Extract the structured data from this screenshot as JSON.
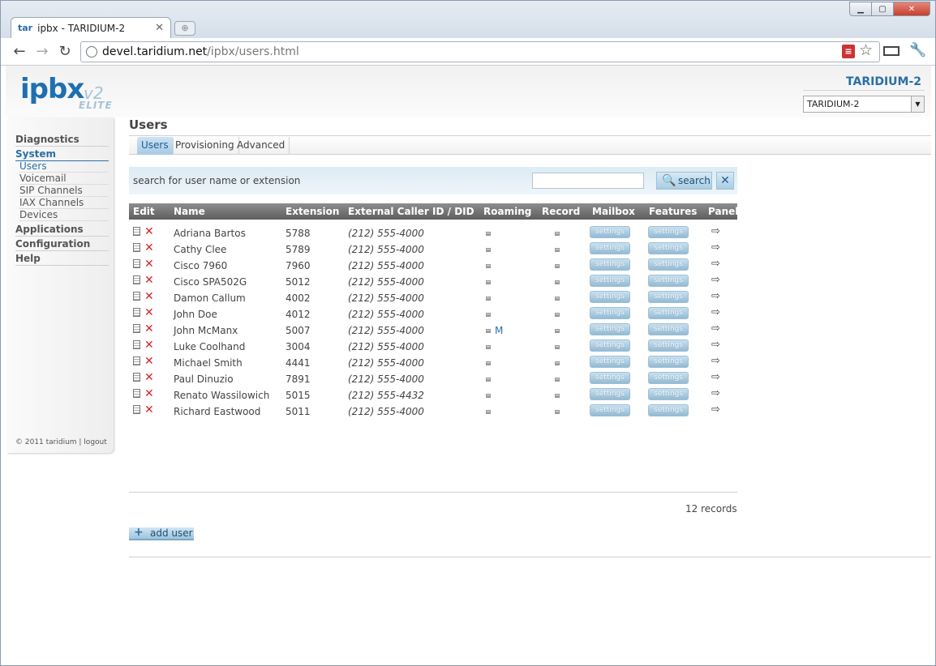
{
  "browser": {
    "tab_title": "ipbx - TARIDIUM-2",
    "tab_favicon": "tar",
    "url_host": "devel.taridium.net",
    "url_path": "/ipbx/users.html"
  },
  "logo": {
    "word": "ipbx",
    "version": "v2",
    "edition": "ELITE"
  },
  "server": {
    "name": "TARIDIUM-2",
    "selected": "TARIDIUM-2"
  },
  "sidebar": {
    "sections": [
      {
        "label": "Diagnostics"
      },
      {
        "label": "System"
      },
      {
        "label": "Applications"
      },
      {
        "label": "Configuration"
      },
      {
        "label": "Help"
      }
    ],
    "system_items": [
      {
        "label": "Users"
      },
      {
        "label": "Voicemail"
      },
      {
        "label": "SIP Channels"
      },
      {
        "label": "IAX Channels"
      },
      {
        "label": "Devices"
      }
    ],
    "footer": "© 2011 taridium | logout"
  },
  "main": {
    "title": "Users",
    "tabs": [
      {
        "label": "Users"
      },
      {
        "label": "Provisioning"
      },
      {
        "label": "Advanced"
      }
    ],
    "search": {
      "label": "search for user name or extension",
      "value": "",
      "button_label": "search"
    },
    "columns": [
      "Edit",
      "Name",
      "Extension",
      "External Caller ID / DID",
      "Roaming",
      "Record",
      "Mailbox",
      "Features",
      "Panel"
    ],
    "settings_label": "settings",
    "rows": [
      {
        "name": "Adriana Bartos",
        "extension": "5788",
        "did": "(212) 555-4000",
        "roaming": ""
      },
      {
        "name": "Cathy Clee",
        "extension": "5789",
        "did": "(212) 555-4000",
        "roaming": ""
      },
      {
        "name": "Cisco 7960",
        "extension": "7960",
        "did": "(212) 555-4000",
        "roaming": ""
      },
      {
        "name": "Cisco SPA502G",
        "extension": "5012",
        "did": "(212) 555-4000",
        "roaming": ""
      },
      {
        "name": "Damon Callum",
        "extension": "4002",
        "did": "(212) 555-4000",
        "roaming": ""
      },
      {
        "name": "John Doe",
        "extension": "4012",
        "did": "(212) 555-4000",
        "roaming": ""
      },
      {
        "name": "John McManx",
        "extension": "5007",
        "did": "(212) 555-4000",
        "roaming": "M"
      },
      {
        "name": "Luke Coolhand",
        "extension": "3004",
        "did": "(212) 555-4000",
        "roaming": ""
      },
      {
        "name": "Michael Smith",
        "extension": "4441",
        "did": "(212) 555-4000",
        "roaming": ""
      },
      {
        "name": "Paul Dinuzio",
        "extension": "7891",
        "did": "(212) 555-4000",
        "roaming": ""
      },
      {
        "name": "Renato Wassilowich",
        "extension": "5015",
        "did": "(212) 555-4432",
        "roaming": ""
      },
      {
        "name": "Richard Eastwood",
        "extension": "5011",
        "did": "(212) 555-4000",
        "roaming": ""
      }
    ],
    "records_label": "12 records",
    "add_user_label": "add user"
  }
}
